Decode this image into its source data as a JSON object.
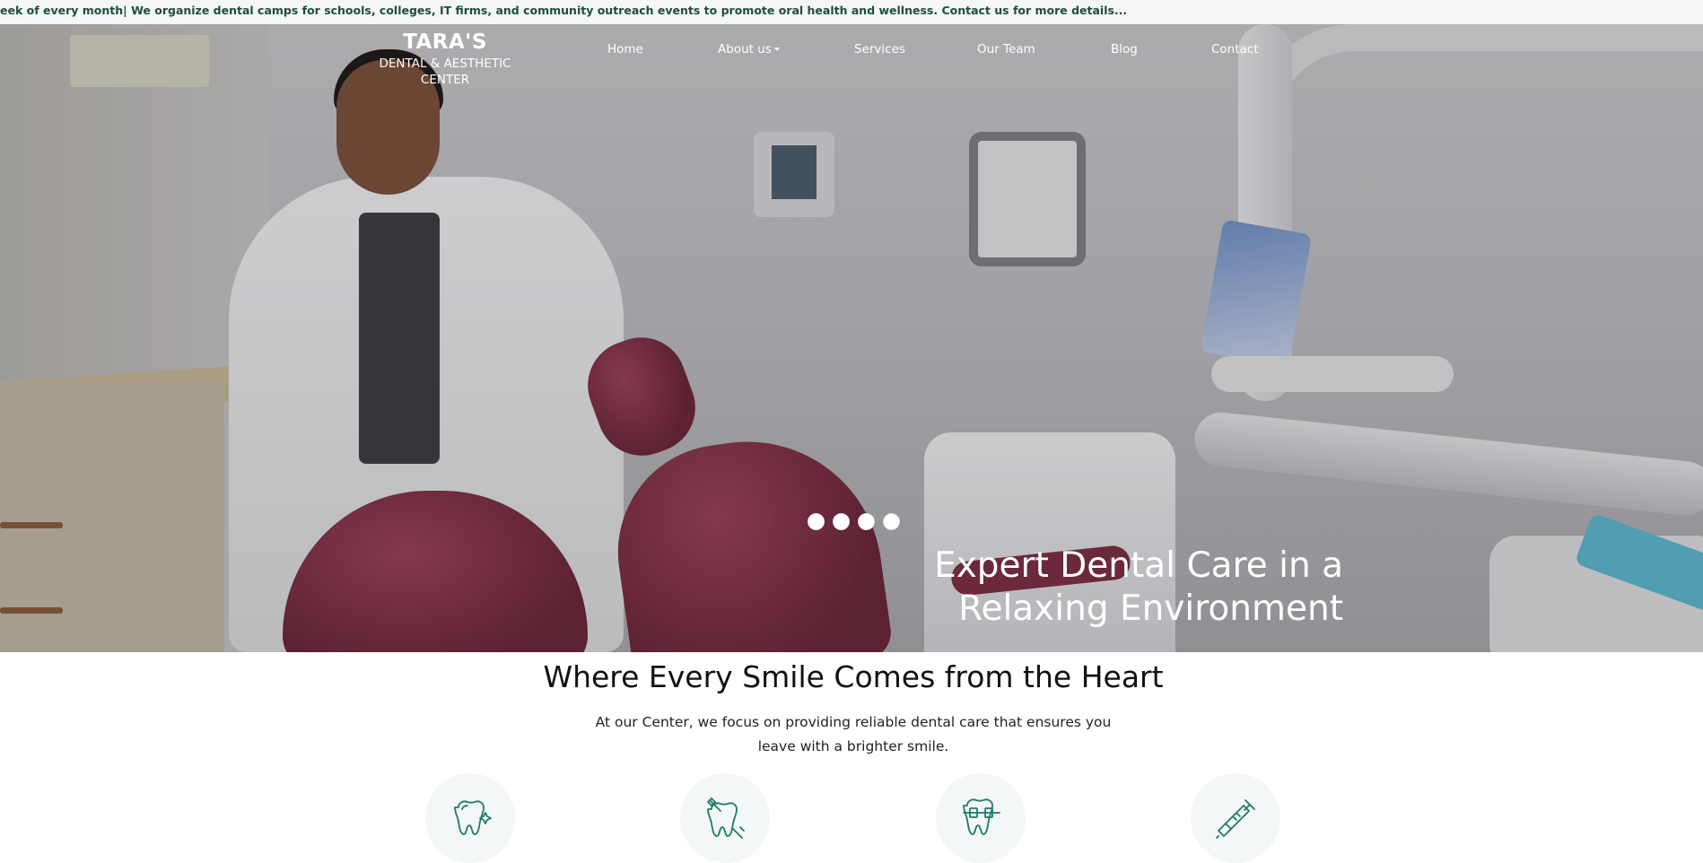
{
  "ticker": {
    "text": "eek of every month| We organize dental camps for schools, colleges, IT firms, and community outreach events to promote oral health and wellness. Contact us for more details..."
  },
  "logo": {
    "title": "TARA'S",
    "subtitle": "DENTAL & AESTHETIC CENTER"
  },
  "nav": {
    "items": [
      {
        "label": "Home"
      },
      {
        "label": "About us"
      },
      {
        "label": "Services"
      },
      {
        "label": "Our Team"
      },
      {
        "label": "Blog"
      },
      {
        "label": "Contact"
      }
    ]
  },
  "hero": {
    "heading_line1": "Expert Dental Care in a",
    "heading_line2": "Relaxing Environment",
    "slide_count": 4
  },
  "intro": {
    "title": "Where Every Smile Comes from the Heart",
    "text": "At our Center, we focus on providing reliable dental care that ensures you leave with a brighter smile."
  },
  "features": [
    {
      "icon": "sparkling-tooth-icon"
    },
    {
      "icon": "tooth-with-brush-icon"
    },
    {
      "icon": "tooth-with-braces-icon"
    },
    {
      "icon": "syringe-icon"
    }
  ],
  "colors": {
    "accent": "#1f7a6a",
    "ticker_text": "#1f4e3a"
  }
}
